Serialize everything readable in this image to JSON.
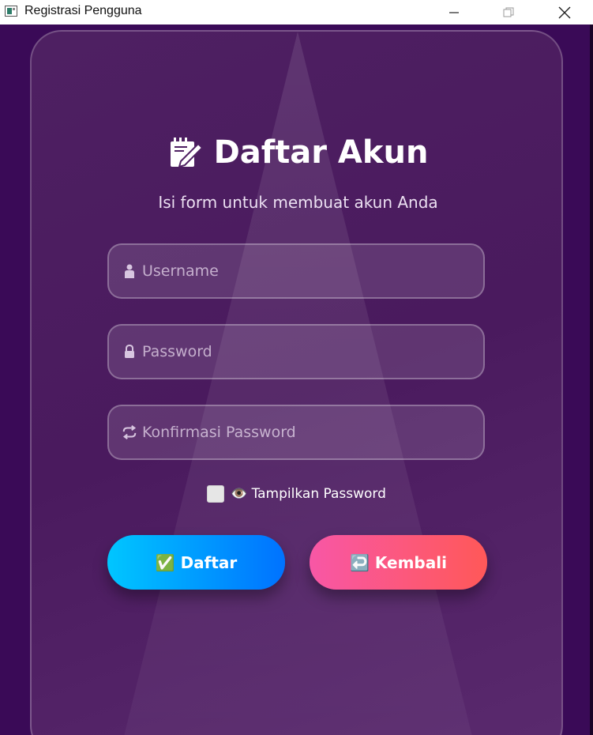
{
  "window": {
    "title": "Registrasi Pengguna"
  },
  "form": {
    "heading": "Daftar Akun",
    "heading_icon": "memo-pencil-icon",
    "subtitle": "Isi form untuk membuat akun Anda",
    "username": {
      "placeholder": "Username",
      "value": "",
      "icon": "person-icon"
    },
    "password": {
      "placeholder": "Password",
      "value": "",
      "icon": "lock-icon"
    },
    "confirm_password": {
      "placeholder": "Konfirmasi Password",
      "value": "",
      "icon": "repeat-arrows-icon"
    },
    "show_password": {
      "label": "👁️ Tampilkan Password",
      "checked": false
    },
    "submit_button": {
      "label": "✅ Daftar"
    },
    "back_button": {
      "label": "↩️ Kembali"
    }
  },
  "colors": {
    "background": "#3a0a57",
    "card": "#4e2062",
    "submit_gradient": [
      "#00c6ff",
      "#0072ff"
    ],
    "back_gradient": [
      "#f857a6",
      "#ff5858"
    ]
  }
}
